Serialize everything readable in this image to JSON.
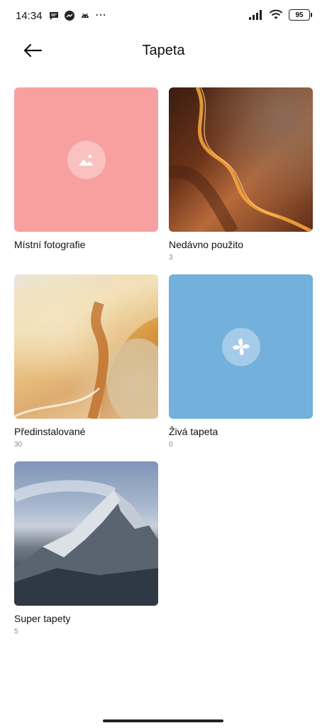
{
  "status_bar": {
    "time": "14:34",
    "dots": "⋯",
    "battery": "95",
    "icons": [
      "message-icon",
      "messenger-icon",
      "android-icon",
      "signal-icon",
      "wifi-icon",
      "battery-icon"
    ]
  },
  "header": {
    "title": "Tapeta",
    "back_icon": "arrow-left-icon"
  },
  "tiles": [
    {
      "label": "Místní fotografie",
      "count": "",
      "icon": "image-icon",
      "color": "#f8a0a0"
    },
    {
      "label": "Nedávno použito",
      "count": "3"
    },
    {
      "label": "Předinstalované",
      "count": "30"
    },
    {
      "label": "Živá tapeta",
      "count": "0",
      "icon": "pinwheel-icon",
      "color": "#73b0db"
    },
    {
      "label": "Super tapety",
      "count": "5"
    }
  ]
}
